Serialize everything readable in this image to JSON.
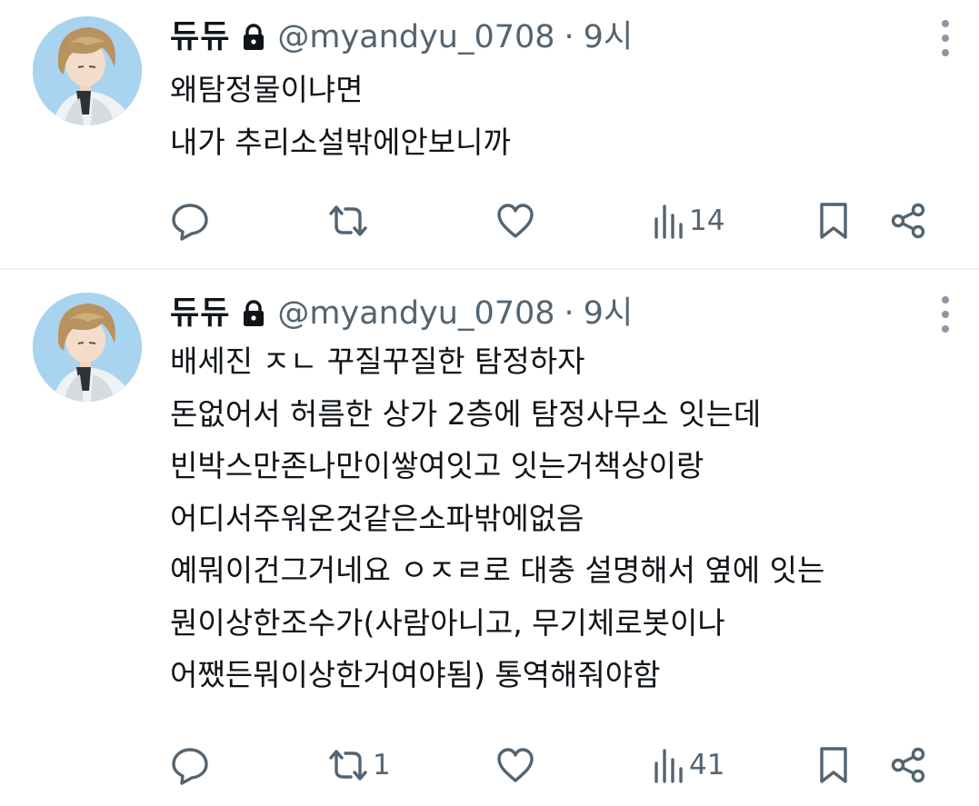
{
  "tweets": [
    {
      "display_name": "듀듀",
      "handle": "@myandyu_0708",
      "separator": "·",
      "time": "9시",
      "lines": [
        "왜탐정물이냐면",
        "내가 추리소설밖에안보니까"
      ],
      "stats": {
        "replies": "",
        "retweets": "",
        "likes": "",
        "views": "14"
      }
    },
    {
      "display_name": "듀듀",
      "handle": "@myandyu_0708",
      "separator": "·",
      "time": "9시",
      "lines": [
        "배세진 ㅈㄴ 꾸질꾸질한 탐정하자",
        "돈없어서 허름한 상가 2층에 탐정사무소 잇는데",
        "빈박스만존나만이쌓여잇고 잇는거책상이랑",
        "어디서주워온것같은소파밖에없음",
        "예뭐이건그거네요 ㅇㅈㄹ로 대충 설명해서 옆에 잇는",
        "뭔이상한조수가(사람아니고, 무기체로봇이나",
        "어쨌든뭐이상한거여야됨) 통역해줘야함"
      ],
      "stats": {
        "replies": "",
        "retweets": "1",
        "likes": "",
        "views": "41"
      }
    }
  ],
  "icons": {
    "lock": "lock-icon",
    "more": "more-vertical-icon",
    "reply": "reply-icon",
    "retweet": "retweet-icon",
    "like": "heart-icon",
    "views": "views-chart-icon",
    "bookmark": "bookmark-icon",
    "share": "share-icon"
  },
  "colors": {
    "text": "#0f1419",
    "secondary": "#536471",
    "divider": "#eff3f4",
    "avatar_bg": "#a9d4ef"
  }
}
